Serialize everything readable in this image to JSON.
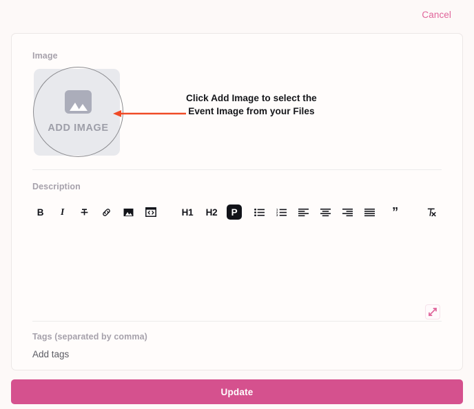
{
  "topbar": {
    "cancel_label": "Cancel"
  },
  "form": {
    "image": {
      "label": "Image",
      "placeholder_button_label": "ADD IMAGE",
      "placeholder_icon": "image-placeholder-icon"
    },
    "description": {
      "label": "Description",
      "content": "",
      "toolbar": [
        {
          "name": "bold-button",
          "glyph": "B",
          "kind": "text",
          "active": false
        },
        {
          "name": "italic-button",
          "glyph": "I",
          "kind": "text",
          "active": false
        },
        {
          "name": "strikethrough-button",
          "glyph": "",
          "kind": "icon",
          "active": false
        },
        {
          "name": "link-button",
          "glyph": "",
          "kind": "icon",
          "active": false
        },
        {
          "name": "insert-image-button",
          "glyph": "",
          "kind": "icon",
          "active": false
        },
        {
          "name": "code-block-button",
          "glyph": "",
          "kind": "icon",
          "active": false
        },
        {
          "name": "heading-1-button",
          "glyph": "H1",
          "kind": "text",
          "active": false
        },
        {
          "name": "heading-2-button",
          "glyph": "H2",
          "kind": "text",
          "active": false
        },
        {
          "name": "paragraph-button",
          "glyph": "P",
          "kind": "text",
          "active": true
        },
        {
          "name": "bullet-list-button",
          "glyph": "",
          "kind": "icon",
          "active": false
        },
        {
          "name": "numbered-list-button",
          "glyph": "",
          "kind": "icon",
          "active": false
        },
        {
          "name": "align-left-button",
          "glyph": "",
          "kind": "icon",
          "active": false
        },
        {
          "name": "align-center-button",
          "glyph": "",
          "kind": "icon",
          "active": false
        },
        {
          "name": "align-right-button",
          "glyph": "",
          "kind": "icon",
          "active": false
        },
        {
          "name": "align-justify-button",
          "glyph": "",
          "kind": "icon",
          "active": false
        },
        {
          "name": "blockquote-button",
          "glyph": "”",
          "kind": "text",
          "active": false
        },
        {
          "name": "clear-formatting-button",
          "glyph": "",
          "kind": "icon",
          "active": false
        },
        {
          "name": "undo-button",
          "glyph": "",
          "kind": "icon",
          "active": false
        },
        {
          "name": "redo-button",
          "glyph": "",
          "kind": "icon",
          "active": false
        }
      ],
      "expand_icon": "expand-fullscreen-icon"
    },
    "tags": {
      "label": "Tags (separated by comma)",
      "value": "",
      "placeholder": "Add tags"
    }
  },
  "footer": {
    "submit_label": "Update"
  },
  "annotation": {
    "text": "Click Add Image to select the\nEvent Image from your Files",
    "arrow": "left-arrow-annotation"
  },
  "colors": {
    "accent": "#d5518e",
    "cancel_link": "#e0649a",
    "annotation_arrow": "#f04a26",
    "page_background": "#fdf9f8",
    "card_background": "#fffcfb",
    "label_text": "#a6a1ab",
    "toolbar_active_bg": "#121319"
  }
}
